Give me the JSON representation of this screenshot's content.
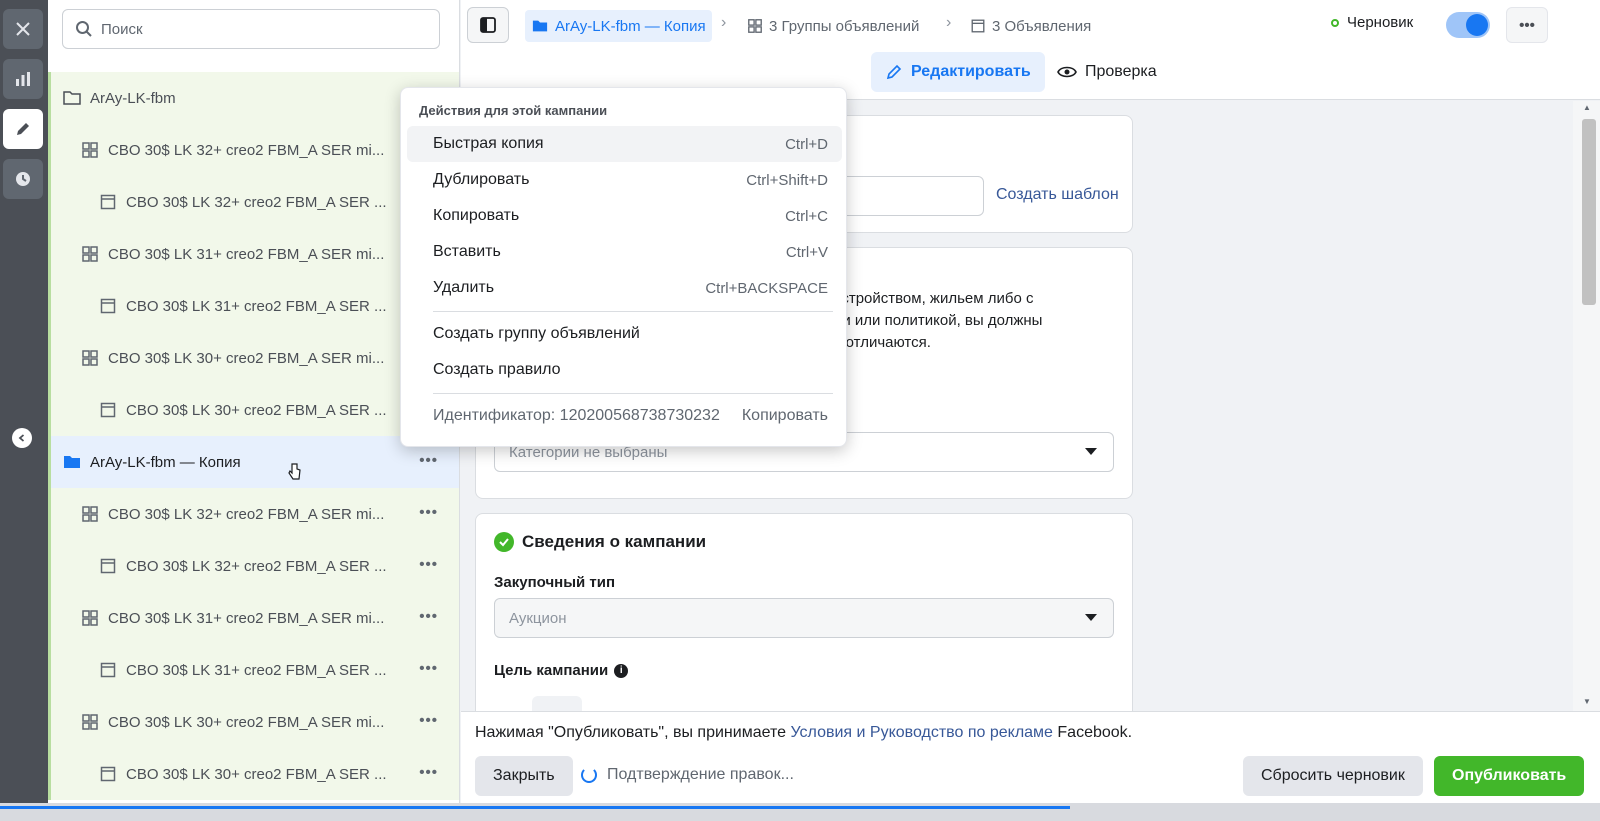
{
  "search": {
    "placeholder": "Поиск"
  },
  "tree": {
    "items": [
      {
        "label": "ArAy-LK-fbm",
        "type": "campaign"
      },
      {
        "label": "CBO 30$ LK 32+ creo2 FBM_A SER mi...",
        "type": "adset"
      },
      {
        "label": "CBO 30$ LK 32+ creo2 FBM_A SER ...",
        "type": "ad"
      },
      {
        "label": "CBO 30$ LK 31+ creo2 FBM_A SER mi...",
        "type": "adset"
      },
      {
        "label": "CBO 30$ LK 31+ creo2 FBM_A SER ...",
        "type": "ad"
      },
      {
        "label": "CBO 30$ LK 30+ creo2 FBM_A SER mi...",
        "type": "adset"
      },
      {
        "label": "CBO 30$ LK 30+ creo2 FBM_A SER ...",
        "type": "ad"
      },
      {
        "label": "ArAy-LK-fbm — Копия",
        "type": "campaign"
      },
      {
        "label": "CBO 30$ LK 32+ creo2 FBM_A SER mi...",
        "type": "adset"
      },
      {
        "label": "CBO 30$ LK 32+ creo2 FBM_A SER ...",
        "type": "ad"
      },
      {
        "label": "CBO 30$ LK 31+ creo2 FBM_A SER mi...",
        "type": "adset"
      },
      {
        "label": "CBO 30$ LK 31+ creo2 FBM_A SER ...",
        "type": "ad"
      },
      {
        "label": "CBO 30$ LK 30+ creo2 FBM_A SER mi...",
        "type": "adset"
      },
      {
        "label": "CBO 30$ LK 30+ creo2 FBM_A SER ...",
        "type": "ad"
      }
    ]
  },
  "header": {
    "crumb_campaign": "ArAy-LK-fbm — Копия",
    "crumb_adsets": "3 Группы объявлений",
    "crumb_ads": "3 Объявления",
    "status": "Черновик",
    "tab_edit": "Редактировать",
    "tab_review": "Проверка"
  },
  "menu": {
    "heading": "Действия для этой кампании",
    "items": [
      {
        "label": "Быстрая копия",
        "shortcut": "Ctrl+D"
      },
      {
        "label": "Дублировать",
        "shortcut": "Ctrl+Shift+D"
      },
      {
        "label": "Копировать",
        "shortcut": "Ctrl+C"
      },
      {
        "label": "Вставить",
        "shortcut": "Ctrl+V"
      },
      {
        "label": "Удалить",
        "shortcut": "Ctrl+BACKSPACE"
      },
      {
        "label": "Создать группу объявлений"
      },
      {
        "label": "Создать правило"
      }
    ],
    "id_label": "Идентификатор: 120200568738730232",
    "id_copy": "Копировать"
  },
  "content": {
    "create_template": "Создать шаблон",
    "special_desc_1": "устройством, жильем либо с",
    "special_desc_2": "ии или политикой, вы должны",
    "special_desc_3": "х отличаются.",
    "categories_placeholder": "Категории не выбраны",
    "campaign_section_title": "Сведения о кампании",
    "buying_type_label": "Закупочный тип",
    "buying_type_value": "Аукцион",
    "objective_label": "Цель кампании"
  },
  "footer": {
    "terms_prefix": "Нажимая \"Опубликовать\", вы принимаете ",
    "terms_link": "Условия и Руководство по рекламе",
    "terms_suffix": " Facebook.",
    "close": "Закрыть",
    "pending": "Подтверждение правок...",
    "reset": "Сбросить черновик",
    "publish": "Опубликовать"
  },
  "colors": {
    "accent": "#1877f2",
    "publish": "#42b72a",
    "link": "#385898"
  }
}
